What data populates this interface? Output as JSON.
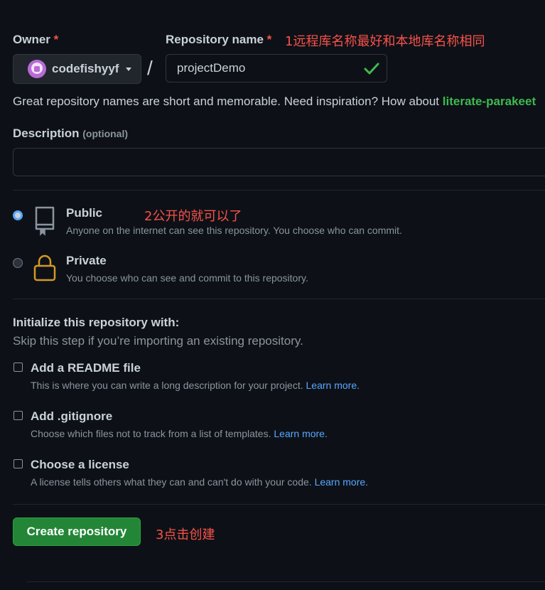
{
  "owner": {
    "label": "Owner",
    "required_mark": "*",
    "selected": "codefishyyf"
  },
  "repo": {
    "label": "Repository name",
    "required_mark": "*",
    "value": "projectDemo"
  },
  "separator": "/",
  "name_hint": {
    "text": "Great repository names are short and memorable. Need inspiration? How about ",
    "suggestion": "literate-parakeet"
  },
  "description": {
    "label": "Description",
    "optional": "(optional)",
    "value": ""
  },
  "visibility": {
    "public": {
      "title": "Public",
      "subtitle": "Anyone on the internet can see this repository. You choose who can commit.",
      "selected": true
    },
    "private": {
      "title": "Private",
      "subtitle": "You choose who can see and commit to this repository.",
      "selected": false
    }
  },
  "init": {
    "heading": "Initialize this repository with:",
    "subheading": "Skip this step if you’re importing an existing repository.",
    "options": [
      {
        "title": "Add a README file",
        "desc": "This is where you can write a long description for your project.",
        "link": "Learn more."
      },
      {
        "title": "Add .gitignore",
        "desc": "Choose which files not to track from a list of templates.",
        "link": "Learn more."
      },
      {
        "title": "Choose a license",
        "desc": "A license tells others what they can and can't do with your code.",
        "link": "Learn more."
      }
    ]
  },
  "create_button": "Create repository",
  "annotations": [
    "1远程库名称最好和本地库名称相同",
    "2公开的就可以了",
    "3点击创建"
  ],
  "colors": {
    "accent": "#58a6ff",
    "success": "#3fb950",
    "button": "#238636",
    "annotation": "#f85149"
  }
}
